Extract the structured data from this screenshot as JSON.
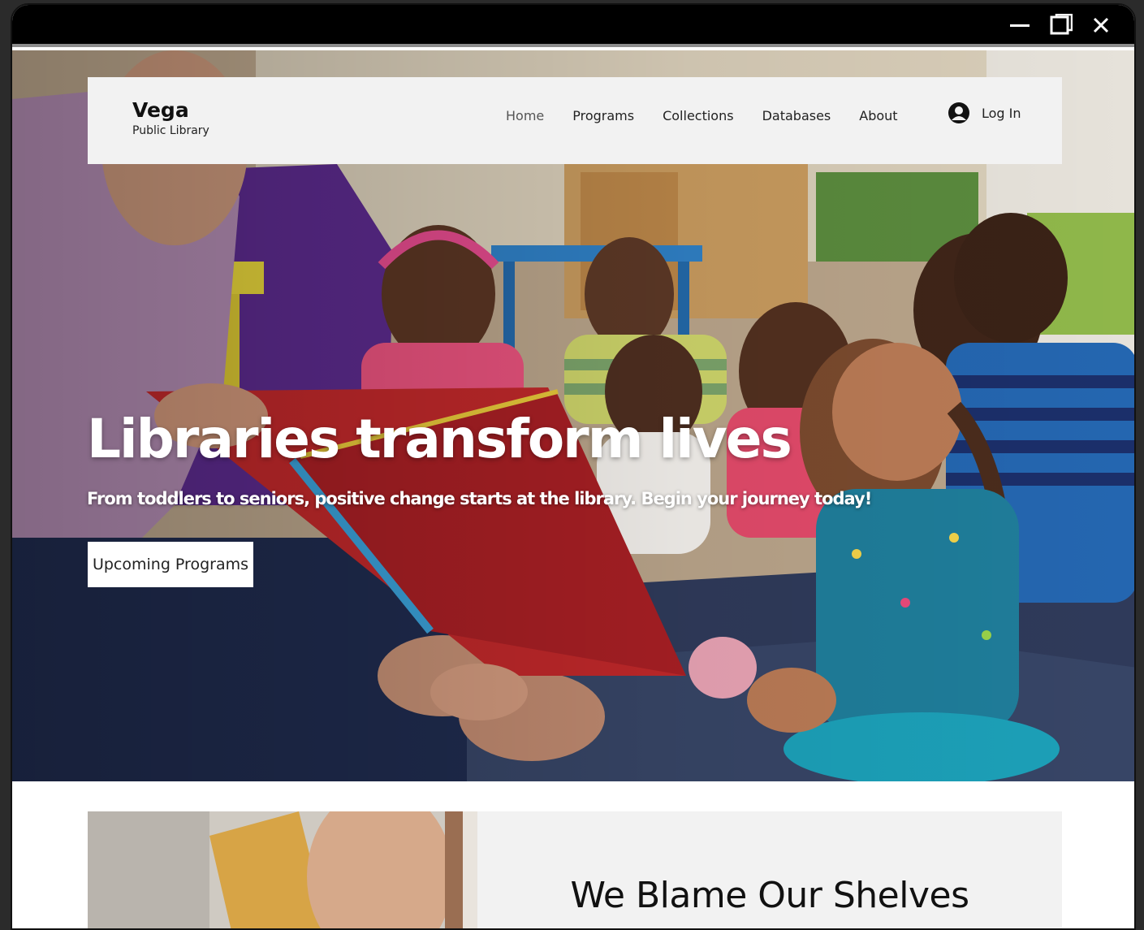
{
  "window": {
    "controls": {
      "minimize_icon": "minimize-icon",
      "maximize_icon": "restore-icon",
      "close_icon": "close-icon"
    }
  },
  "header": {
    "brand_name": "Vega",
    "brand_sub": "Public Library",
    "nav": [
      {
        "label": "Home"
      },
      {
        "label": "Programs"
      },
      {
        "label": "Collections"
      },
      {
        "label": "Databases"
      },
      {
        "label": "About"
      }
    ],
    "login_label": "Log In",
    "login_icon": "user-avatar-icon"
  },
  "hero": {
    "title": "Libraries transform lives",
    "subtitle": "From toddlers to seniors, positive change starts at the library. Begin your journey today!",
    "cta_label": "Upcoming Programs"
  },
  "feature": {
    "title": "We Blame Our Shelves"
  },
  "colors": {
    "header_bg": "#f2f2f2",
    "titlebar": "#000000",
    "text": "#222222"
  }
}
